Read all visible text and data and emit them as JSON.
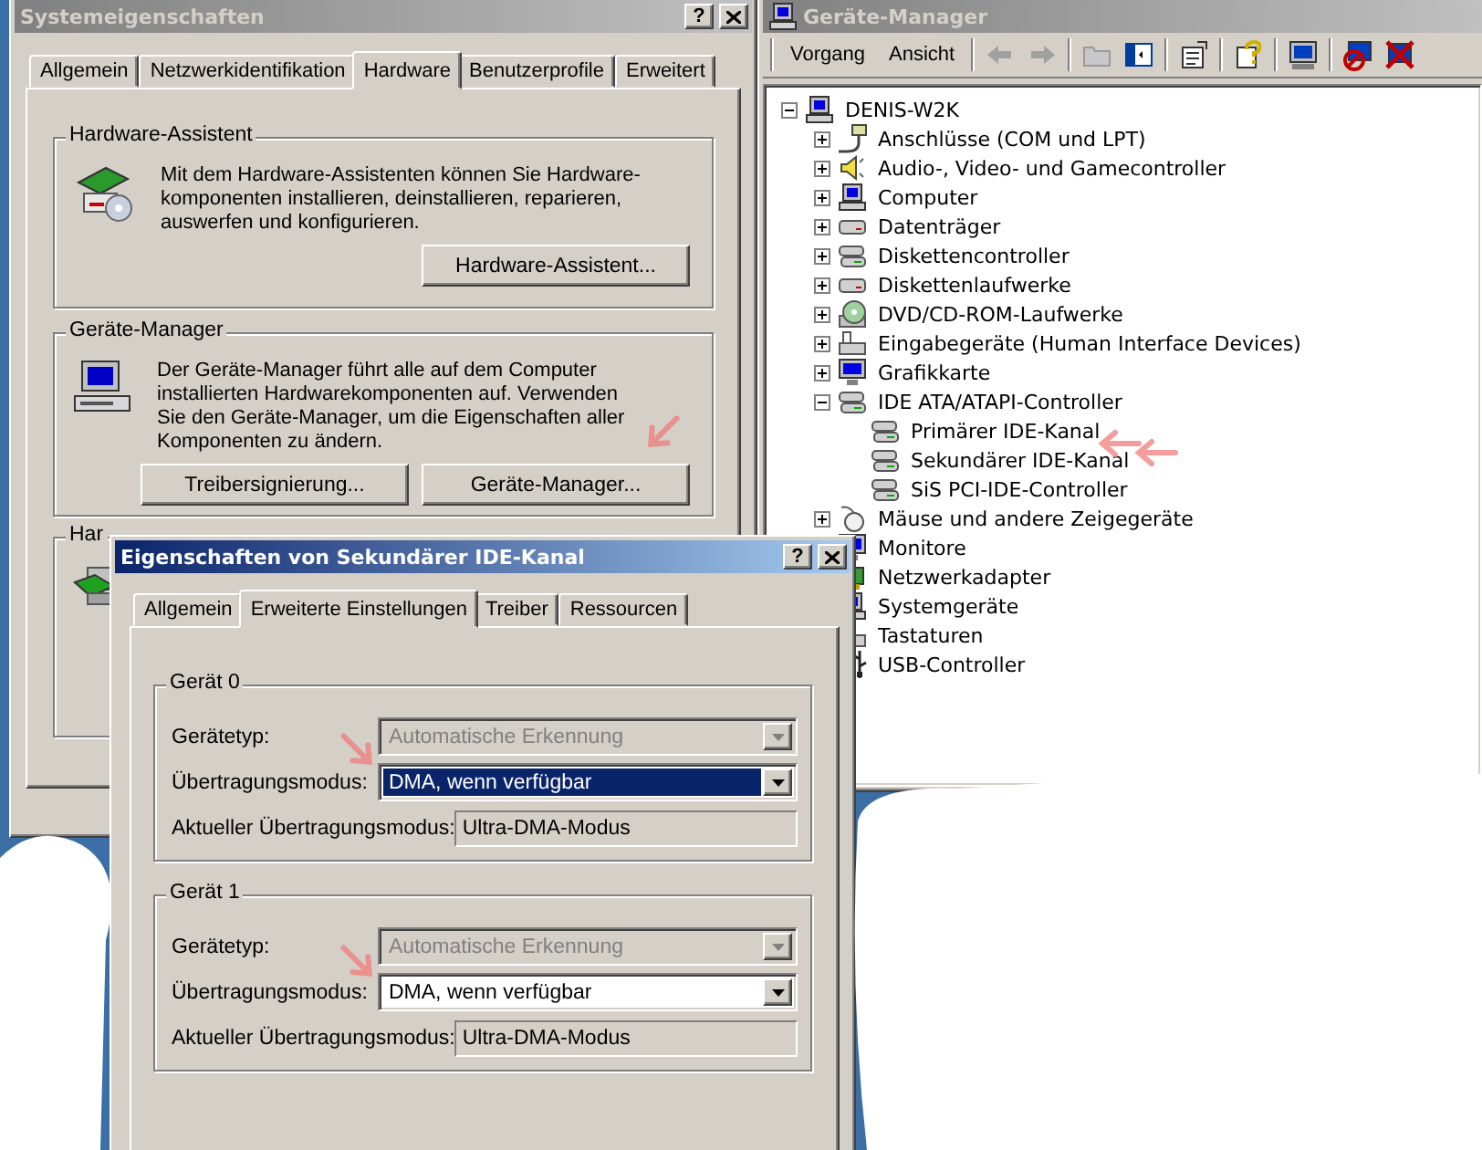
{
  "system_properties": {
    "title": "Systemeigenschaften",
    "help": "?",
    "tabs": [
      {
        "label": "Allgemein",
        "selected": false
      },
      {
        "label": "Netzwerkidentifikation",
        "selected": false
      },
      {
        "label": "Hardware",
        "selected": true
      },
      {
        "label": "Benutzerprofile",
        "selected": false
      },
      {
        "label": "Erweitert",
        "selected": false
      }
    ],
    "groups": [
      {
        "kind": "wizard",
        "title": "Hardware-Assistent",
        "text": "Mit dem Hardware-Assistenten können Sie Hardware-komponenten installieren, deinstallieren, reparieren, auswerfen und konfigurieren.",
        "buttons": [
          "Hardware-Assistent..."
        ]
      },
      {
        "kind": "device_manager",
        "title": "Geräte-Manager",
        "text": "Der Geräte-Manager führt alle auf dem Computer installierten Hardwarekomponenten auf. Verwenden Sie den Geräte-Manager, um die Eigenschaften aller Komponenten zu ändern.",
        "buttons": [
          "Treibersignierung...",
          "Geräte-Manager..."
        ]
      },
      {
        "kind": "profiles",
        "title": "Har"
      }
    ]
  },
  "device_manager": {
    "title": "Geräte-Manager",
    "menu": [
      "Vorgang",
      "Ansicht"
    ],
    "tree": {
      "label": "DENIS-W2K",
      "kind": "computer",
      "expanded": true,
      "children": [
        {
          "label": "Anschlüsse (COM und LPT)",
          "kind": "port",
          "expanded": false
        },
        {
          "label": "Audio-, Video- und Gamecontroller",
          "kind": "audio",
          "expanded": false
        },
        {
          "label": "Computer",
          "kind": "computer",
          "expanded": false
        },
        {
          "label": "Datenträger",
          "kind": "disk",
          "expanded": false
        },
        {
          "label": "Diskettencontroller",
          "kind": "controller",
          "expanded": false
        },
        {
          "label": "Diskettenlaufwerke",
          "kind": "disk",
          "expanded": false
        },
        {
          "label": "DVD/CD-ROM-Laufwerke",
          "kind": "cdrom",
          "expanded": false
        },
        {
          "label": "Eingabegeräte (Human Interface Devices)",
          "kind": "input",
          "expanded": false
        },
        {
          "label": "Grafikkarte",
          "kind": "monitor",
          "expanded": false
        },
        {
          "label": "IDE ATA/ATAPI-Controller",
          "kind": "controller",
          "expanded": true,
          "children": [
            {
              "label": "Primärer IDE-Kanal",
              "kind": "controller"
            },
            {
              "label": "Sekundärer IDE-Kanal",
              "kind": "controller"
            },
            {
              "label": "SiS PCI-IDE-Controller",
              "kind": "controller"
            }
          ]
        },
        {
          "label": "Mäuse und andere Zeigegeräte",
          "kind": "mouse",
          "expanded": false
        },
        {
          "label": "Monitore",
          "kind": "monitor"
        },
        {
          "label": "Netzwerkadapter",
          "kind": "network"
        },
        {
          "label": "Systemgeräte",
          "kind": "computer"
        },
        {
          "label": "Tastaturen",
          "kind": "input"
        },
        {
          "label": "USB-Controller",
          "kind": "usb"
        }
      ]
    }
  },
  "ide_dialog": {
    "title": "Eigenschaften von Sekundärer IDE-Kanal",
    "help": "?",
    "tabs": [
      {
        "label": "Allgemein",
        "selected": false
      },
      {
        "label": "Erweiterte Einstellungen",
        "selected": true
      },
      {
        "label": "Treiber",
        "selected": false
      },
      {
        "label": "Ressourcen",
        "selected": false
      }
    ],
    "groups": [
      {
        "title": "Gerät 0",
        "fields": [
          {
            "label": "Gerätetyp:",
            "kind": "dropdown",
            "value": "Automatische Erkennung",
            "disabled": true,
            "focused": false
          },
          {
            "label": "Übertragungsmodus:",
            "kind": "dropdown",
            "value": "DMA, wenn verfügbar",
            "disabled": false,
            "focused": true
          },
          {
            "label": "Aktueller Übertragungsmodus:",
            "kind": "readonly",
            "value": "Ultra-DMA-Modus"
          }
        ]
      },
      {
        "title": "Gerät 1",
        "fields": [
          {
            "label": "Gerätetyp:",
            "kind": "dropdown",
            "value": "Automatische Erkennung",
            "disabled": true,
            "focused": false
          },
          {
            "label": "Übertragungsmodus:",
            "kind": "dropdown",
            "value": "DMA, wenn verfügbar",
            "disabled": false,
            "focused": false
          },
          {
            "label": "Aktueller Übertragungsmodus:",
            "kind": "readonly",
            "value": "Ultra-DMA-Modus"
          }
        ]
      }
    ]
  }
}
